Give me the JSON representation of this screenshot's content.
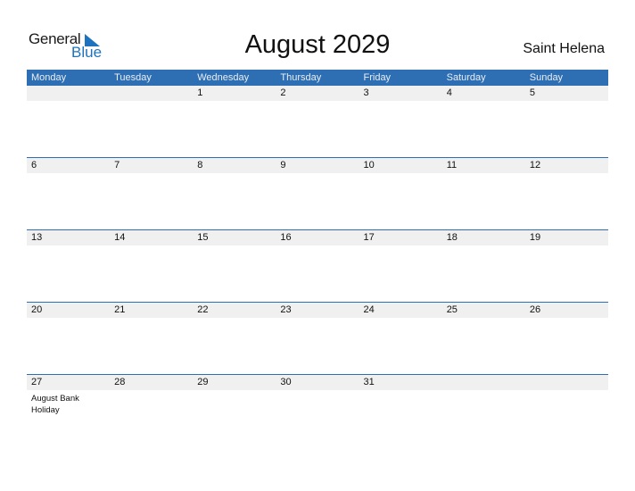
{
  "logo": {
    "word1": "General",
    "word2": "Blue"
  },
  "title": "August 2029",
  "country": "Saint Helena",
  "colors": {
    "header_bg": "#2e6fb3",
    "band": "#f0f0f0",
    "brand": "#1e73be"
  },
  "weekdays": [
    "Monday",
    "Tuesday",
    "Wednesday",
    "Thursday",
    "Friday",
    "Saturday",
    "Sunday"
  ],
  "weeks": [
    {
      "days": [
        "",
        "",
        "1",
        "2",
        "3",
        "4",
        "5"
      ],
      "events": [
        "",
        "",
        "",
        "",
        "",
        "",
        ""
      ]
    },
    {
      "days": [
        "6",
        "7",
        "8",
        "9",
        "10",
        "11",
        "12"
      ],
      "events": [
        "",
        "",
        "",
        "",
        "",
        "",
        ""
      ]
    },
    {
      "days": [
        "13",
        "14",
        "15",
        "16",
        "17",
        "18",
        "19"
      ],
      "events": [
        "",
        "",
        "",
        "",
        "",
        "",
        ""
      ]
    },
    {
      "days": [
        "20",
        "21",
        "22",
        "23",
        "24",
        "25",
        "26"
      ],
      "events": [
        "",
        "",
        "",
        "",
        "",
        "",
        ""
      ]
    },
    {
      "days": [
        "27",
        "28",
        "29",
        "30",
        "31",
        "",
        ""
      ],
      "events": [
        "August Bank Holiday",
        "",
        "",
        "",
        "",
        "",
        ""
      ]
    }
  ]
}
